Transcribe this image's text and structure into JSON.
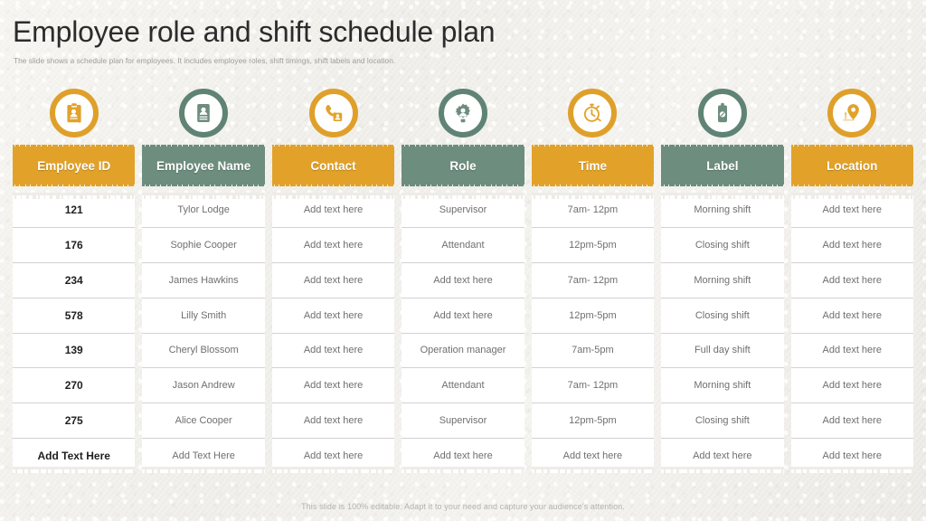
{
  "slide": {
    "title": "Employee role and shift schedule plan",
    "subtitle": "The slide shows a schedule plan for employees. It includes employee roles, shift timings, shift labels and location.",
    "footer": "This slide is 100% editable. Adapt it to your need and capture your audience's attention."
  },
  "colors": {
    "orange": "#e2a229",
    "orange_ring": "#dfa02b",
    "green": "#6d8d7e",
    "green_ring": "#5f8374",
    "background": "#f3f2ee",
    "card": "#ffffff",
    "header_text": "#ffffff",
    "cell_text": "#6f6f6f",
    "id_text": "#1f1f1f"
  },
  "table": {
    "columns": [
      {
        "header": "Employee ID",
        "icon": "id-badge-clipboard-icon",
        "theme": "orange"
      },
      {
        "header": "Employee Name",
        "icon": "id-card-person-icon",
        "theme": "green"
      },
      {
        "header": "Contact",
        "icon": "phone-contact-card-icon",
        "theme": "orange"
      },
      {
        "header": "Role",
        "icon": "gear-person-icon",
        "theme": "green"
      },
      {
        "header": "Time",
        "icon": "stopwatch-icon",
        "theme": "orange"
      },
      {
        "header": "Label",
        "icon": "price-tag-icon",
        "theme": "green"
      },
      {
        "header": "Location",
        "icon": "map-pin-icon",
        "theme": "orange"
      }
    ],
    "rows": [
      [
        "121",
        "Tylor Lodge",
        "Add text here",
        "Supervisor",
        "7am- 12pm",
        "Morning shift",
        "Add text here"
      ],
      [
        "176",
        "Sophie Cooper",
        "Add text here",
        "Attendant",
        "12pm-5pm",
        "Closing shift",
        "Add text here"
      ],
      [
        "234",
        "James Hawkins",
        "Add text here",
        "Add text here",
        "7am- 12pm",
        "Morning shift",
        "Add text here"
      ],
      [
        "578",
        "Lilly Smith",
        "Add text here",
        "Add text here",
        "12pm-5pm",
        "Closing shift",
        "Add text here"
      ],
      [
        "139",
        "Cheryl Blossom",
        "Add text here",
        "Operation manager",
        "7am-5pm",
        "Full day shift",
        "Add text here"
      ],
      [
        "270",
        "Jason Andrew",
        "Add text here",
        "Attendant",
        "7am- 12pm",
        "Morning shift",
        "Add text here"
      ],
      [
        "275",
        "Alice Cooper",
        "Add text here",
        "Supervisor",
        "12pm-5pm",
        "Closing shift",
        "Add text here"
      ],
      [
        "Add Text Here",
        "Add Text Here",
        "Add text here",
        "Add text here",
        "Add text here",
        "Add text here",
        "Add text here"
      ]
    ]
  }
}
